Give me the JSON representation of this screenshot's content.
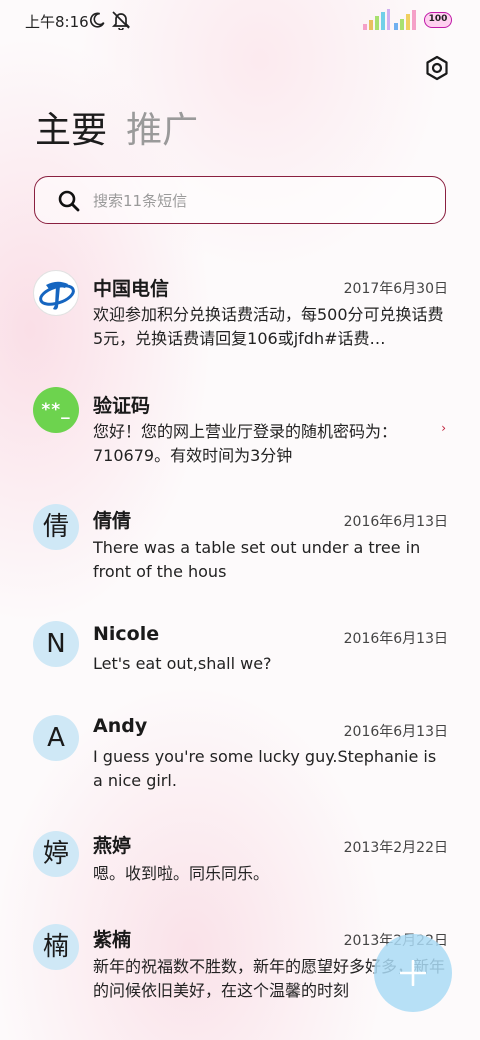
{
  "status_bar": {
    "time": "上午8:16",
    "battery": "100",
    "icons": [
      "moon-icon",
      "mute-icon",
      "signal-icon",
      "signal-icon",
      "battery-icon"
    ]
  },
  "header": {
    "settings_icon": "gear-icon"
  },
  "tabs": [
    {
      "label": "主要",
      "active": true
    },
    {
      "label": "推广",
      "active": false
    }
  ],
  "search": {
    "placeholder": "搜索11条短信",
    "value": ""
  },
  "messages": [
    {
      "sender": "中国电信",
      "date": "2017年6月30日",
      "preview": "欢迎参加积分兑换话费活动，每500分可兑换话费5元，兑换话费请回复106或jfdh#话费…",
      "avatar": "China Telecom logo"
    },
    {
      "sender": "验证码",
      "date": "",
      "preview": "您好！您的网上营业厅登录的随机密码为：710679。有效时间为3分钟",
      "avatar": "**_"
    },
    {
      "sender": "倩倩",
      "date": "2016年6月13日",
      "preview": "There was a table set out under a tree in front of the hous",
      "avatar": "倩"
    },
    {
      "sender": "Nicole",
      "date": "2016年6月13日",
      "preview": "Let's eat out,shall we?",
      "avatar": "N"
    },
    {
      "sender": "Andy",
      "date": "2016年6月13日",
      "preview": "I guess you're some lucky guy.Stephanie is a nice girl.",
      "avatar": "A"
    },
    {
      "sender": "燕婷",
      "date": "2013年2月22日",
      "preview": "嗯。收到啦。同乐同乐。",
      "avatar": "婷"
    },
    {
      "sender": "紫楠",
      "date": "2013年2月22日",
      "preview": "新年的祝福数不胜数，新年的愿望好多好多，新年的问候依旧美好，在这个温馨的时刻",
      "avatar": "楠"
    }
  ],
  "fab": {
    "icon": "plus-icon"
  },
  "colors": {
    "search_border": "#8a2040",
    "avatar_bg": "#cfe8f6",
    "code_avatar_bg": "#6dd34e",
    "fab_bg": "#aadaf5"
  }
}
